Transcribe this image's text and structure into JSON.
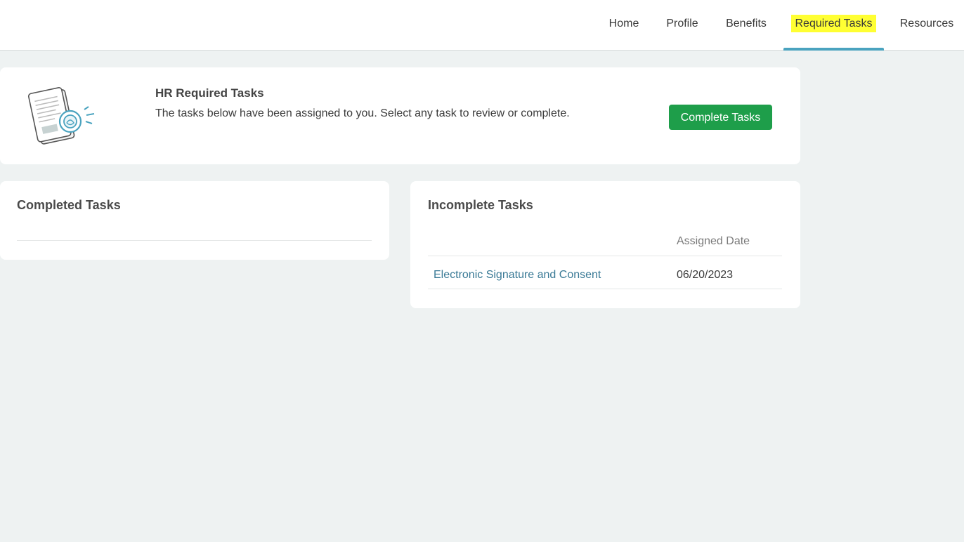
{
  "nav": {
    "items": [
      {
        "label": "Home"
      },
      {
        "label": "Profile"
      },
      {
        "label": "Benefits"
      },
      {
        "label": "Required Tasks"
      },
      {
        "label": "Resources"
      }
    ],
    "active": "Required Tasks"
  },
  "header": {
    "title": "HR Required Tasks",
    "description": "The tasks below have been assigned to you. Select any task to review or complete.",
    "button_label": "Complete Tasks",
    "illustration_icon": "document-signature-icon"
  },
  "completed": {
    "title": "Completed Tasks",
    "rows": []
  },
  "incomplete": {
    "title": "Incomplete Tasks",
    "columns": [
      "",
      "Assigned Date"
    ],
    "rows": [
      {
        "task": "Electronic Signature and Consent",
        "assigned_date": "06/20/2023"
      }
    ]
  },
  "colors": {
    "background": "#eef2f2",
    "button": "#1e9e4a",
    "link": "#3a7a96",
    "active_underline": "#4aa3bf",
    "highlight": "#ffff33"
  }
}
